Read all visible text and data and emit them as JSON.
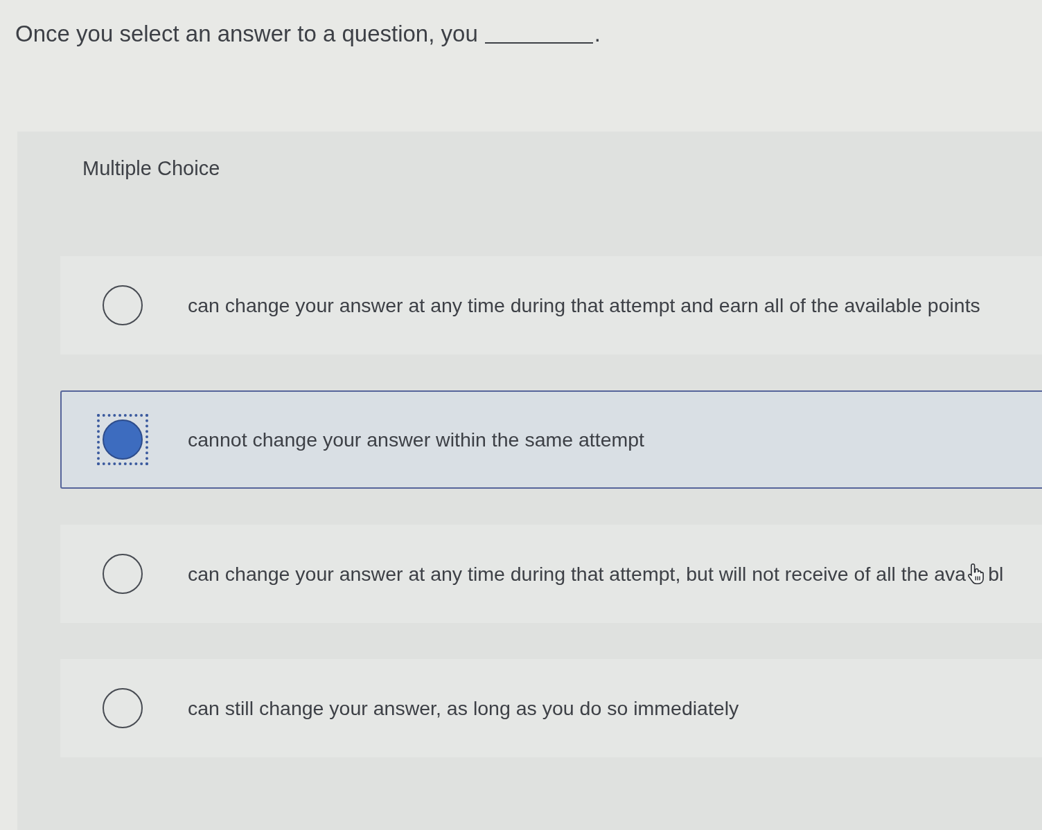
{
  "question": {
    "text_before_blank": "Once you select an answer to a question, you",
    "text_after_blank": "."
  },
  "panel": {
    "heading": "Multiple Choice"
  },
  "options": [
    {
      "text": "can change your answer at any time during that attempt and earn all of the available points",
      "selected": false,
      "focused": false,
      "hovered": false
    },
    {
      "text": "cannot change your answer within the same attempt",
      "selected": true,
      "focused": true,
      "hovered": false
    },
    {
      "text": "can change your answer at any time during that attempt, but will not receive of all the ava",
      "text_after_cursor": "bl",
      "selected": false,
      "focused": false,
      "hovered": true
    },
    {
      "text": "can still change your answer, as long as you do so immediately",
      "selected": false,
      "focused": false,
      "hovered": false
    }
  ]
}
